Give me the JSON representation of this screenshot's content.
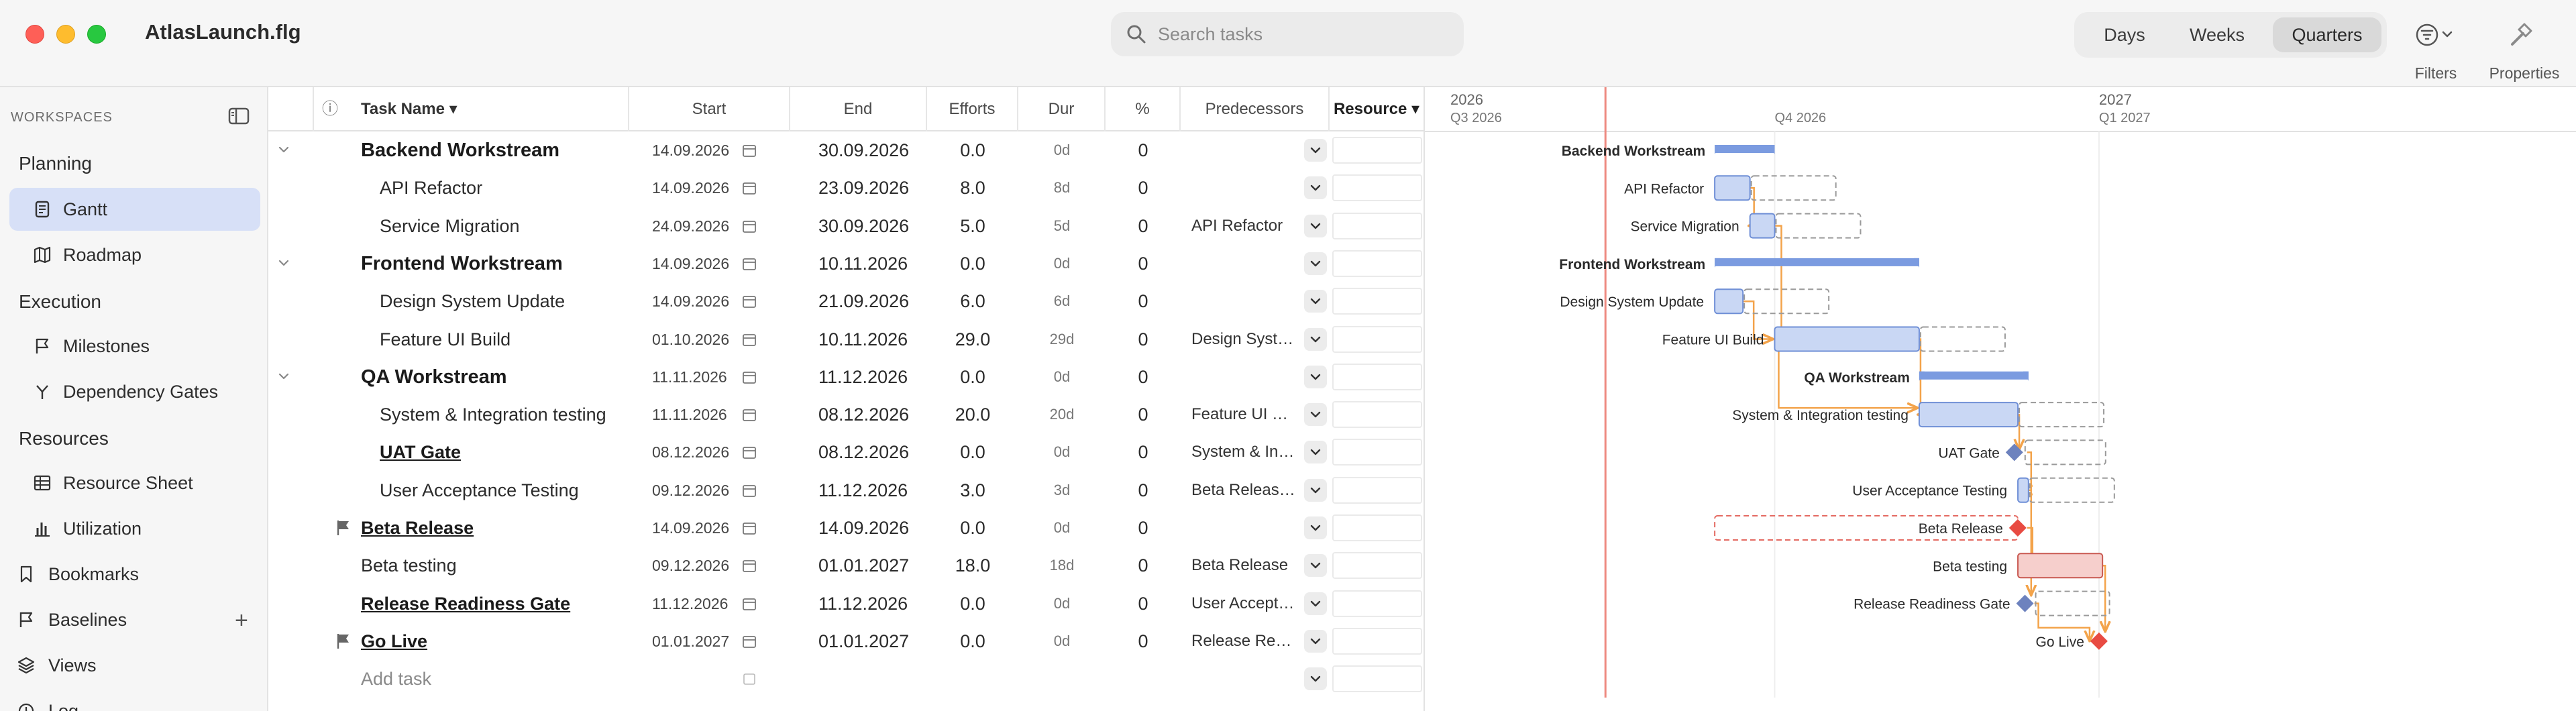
{
  "app": {
    "title": "AtlasLaunch.flg"
  },
  "search": {
    "placeholder": "Search tasks"
  },
  "toolbar": {
    "views": [
      "Days",
      "Weeks",
      "Quarters"
    ],
    "active_view": "Quarters",
    "filters_label": "Filters",
    "properties_label": "Properties"
  },
  "sidebar": {
    "header": "WORKSPACES",
    "groups": [
      "Planning",
      "Execution",
      "Resources"
    ],
    "items": [
      {
        "label": "Gantt",
        "icon": "document-icon",
        "active": true
      },
      {
        "label": "Roadmap",
        "icon": "map-icon"
      },
      {
        "label": "Milestones",
        "icon": "flag-icon"
      },
      {
        "label": "Dependency Gates",
        "icon": "branch-icon"
      },
      {
        "label": "Resource Sheet",
        "icon": "table-icon"
      },
      {
        "label": "Utilization",
        "icon": "bar-chart-icon"
      }
    ],
    "roots": [
      {
        "label": "Bookmarks",
        "icon": "bookmark-icon"
      },
      {
        "label": "Baselines",
        "icon": "flag-icon"
      },
      {
        "label": "Views",
        "icon": "layers-icon"
      },
      {
        "label": "Log",
        "icon": "clock-icon"
      }
    ]
  },
  "table": {
    "columns": {
      "info": "ⓘ",
      "task_name": "Task Name ▾",
      "start": "Start",
      "end": "End",
      "efforts": "Efforts",
      "dur": "Dur",
      "pct": "%",
      "predecessors": "Predecessors",
      "resource": "Resource ▾"
    },
    "rows": [
      {
        "name": "Backend Workstream",
        "kind": "group",
        "start": "14.09.2026",
        "end": "30.09.2026",
        "efforts": "0.0",
        "dur": "0d",
        "pct": "0",
        "pred": ""
      },
      {
        "name": "API Refactor",
        "kind": "task",
        "start": "14.09.2026",
        "end": "23.09.2026",
        "efforts": "8.0",
        "dur": "8d",
        "pct": "0",
        "pred": ""
      },
      {
        "name": "Service Migration",
        "kind": "task",
        "start": "24.09.2026",
        "end": "30.09.2026",
        "efforts": "5.0",
        "dur": "5d",
        "pct": "0",
        "pred": "API Refactor"
      },
      {
        "name": "Frontend Workstream",
        "kind": "group",
        "start": "14.09.2026",
        "end": "10.11.2026",
        "efforts": "0.0",
        "dur": "0d",
        "pct": "0",
        "pred": ""
      },
      {
        "name": "Design System Update",
        "kind": "task",
        "start": "14.09.2026",
        "end": "21.09.2026",
        "efforts": "6.0",
        "dur": "6d",
        "pct": "0",
        "pred": ""
      },
      {
        "name": "Feature UI Build",
        "kind": "task",
        "start": "01.10.2026",
        "end": "10.11.2026",
        "efforts": "29.0",
        "dur": "29d",
        "pct": "0",
        "pred": "Design Syste..."
      },
      {
        "name": "QA Workstream",
        "kind": "group",
        "start": "11.11.2026",
        "end": "11.12.2026",
        "efforts": "0.0",
        "dur": "0d",
        "pct": "0",
        "pred": ""
      },
      {
        "name": "System & Integration testing",
        "kind": "task",
        "start": "11.11.2026",
        "end": "08.12.2026",
        "efforts": "20.0",
        "dur": "20d",
        "pct": "0",
        "pred": "Feature UI Bu..."
      },
      {
        "name": "UAT Gate",
        "kind": "milestone",
        "start": "08.12.2026",
        "end": "08.12.2026",
        "efforts": "0.0",
        "dur": "0d",
        "pct": "0",
        "pred": "System & Inte..."
      },
      {
        "name": "User Acceptance Testing",
        "kind": "task",
        "start": "09.12.2026",
        "end": "11.12.2026",
        "efforts": "3.0",
        "dur": "3d",
        "pct": "0",
        "pred": "Beta Release,..."
      },
      {
        "name": "Beta Release",
        "kind": "milestone-flag",
        "start": "14.09.2026",
        "end": "14.09.2026",
        "efforts": "0.0",
        "dur": "0d",
        "pct": "0",
        "pred": ""
      },
      {
        "name": "Beta testing",
        "kind": "root-task",
        "start": "09.12.2026",
        "end": "01.01.2027",
        "efforts": "18.0",
        "dur": "18d",
        "pct": "0",
        "pred": "Beta Release"
      },
      {
        "name": "Release Readiness Gate",
        "kind": "milestone-root",
        "start": "11.12.2026",
        "end": "11.12.2026",
        "efforts": "0.0",
        "dur": "0d",
        "pct": "0",
        "pred": "User Accepta..."
      },
      {
        "name": "Go Live",
        "kind": "milestone-flag",
        "start": "01.01.2027",
        "end": "01.01.2027",
        "efforts": "0.0",
        "dur": "0d",
        "pct": "0",
        "pred": "Release Read..."
      }
    ],
    "add_task": "Add task"
  },
  "gantt": {
    "timeline": {
      "years": [
        "2026",
        "2027"
      ],
      "quarters": [
        "Q3 2026",
        "Q4 2026",
        "Q1 2027"
      ]
    },
    "bar_labels": [
      "Backend Workstream",
      "API Refactor",
      "Service Migration",
      "Frontend Workstream",
      "Design System Update",
      "Feature UI Build",
      "QA Workstream",
      "System & Integration testing",
      "UAT Gate",
      "User Acceptance Testing",
      "Beta Release",
      "Beta testing",
      "Release Readiness Gate",
      "Go Live"
    ],
    "colors": {
      "task_fill": "#c9d7f4",
      "task_border": "#6f8fd6",
      "summary": "#7b9be0",
      "milestone": "#6d82be",
      "critical_milestone": "#e84b42",
      "critical_fill": "#f6cfcc",
      "critical_border": "#c95a52",
      "today_line": "#ee8a80",
      "dependency": "#f3a34a"
    }
  }
}
